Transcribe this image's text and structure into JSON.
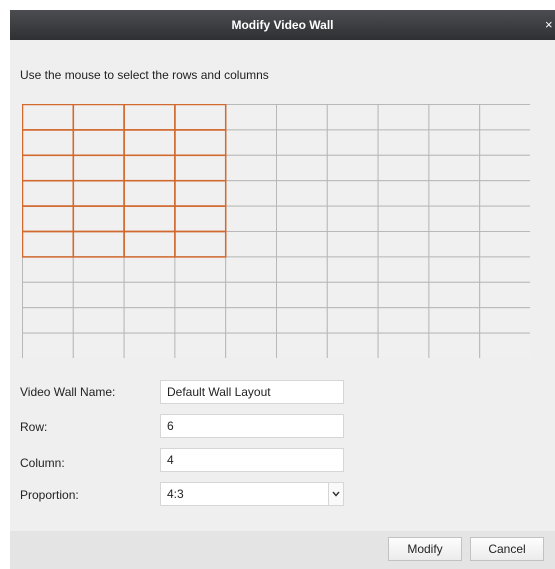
{
  "dialog": {
    "title": "Modify Video Wall",
    "close_glyph": "×"
  },
  "instruction": "Use the mouse to select the rows and columns",
  "grid": {
    "total_rows": 10,
    "total_columns": 10,
    "selected_rows": 6,
    "selected_columns": 4,
    "selection_color": "#d2692e",
    "line_color": "#b8b8b8",
    "cell_color": "#f0f0f0"
  },
  "form": {
    "name_label": "Video Wall Name:",
    "name_value": "Default Wall Layout",
    "row_label": "Row:",
    "row_value": "6",
    "column_label": "Column:",
    "column_value": "4",
    "proportion_label": "Proportion:",
    "proportion_value": "4:3",
    "proportion_icon": "chevron-down-icon"
  },
  "buttons": {
    "modify": "Modify",
    "cancel": "Cancel"
  }
}
